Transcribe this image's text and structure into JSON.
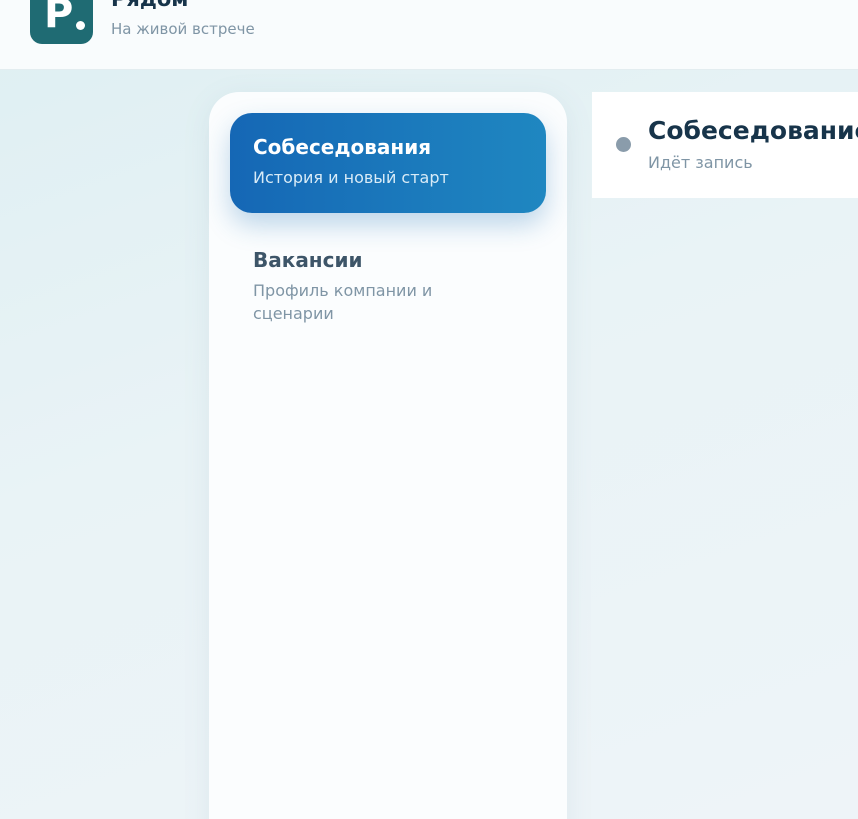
{
  "header": {
    "logo_letter": "P",
    "brand_title": "Рядом",
    "brand_subtitle": "На живой встрече"
  },
  "sidebar": {
    "items": [
      {
        "title": "Собеседования",
        "subtitle": "История и новый старт",
        "active": true
      },
      {
        "title": "Вакансии",
        "subtitle": "Профиль компании и сценарии",
        "active": false
      }
    ]
  },
  "main": {
    "session": {
      "title": "Собеседование",
      "status": "Идёт запись"
    }
  },
  "colors": {
    "brand": "#1f6b73",
    "accent_gradient_start": "#1567b5",
    "accent_gradient_end": "#1f87c1",
    "status_dot": "#8a9cab"
  },
  "icons": {
    "logo": "brand-logo-icon",
    "status": "status-dot-icon"
  }
}
